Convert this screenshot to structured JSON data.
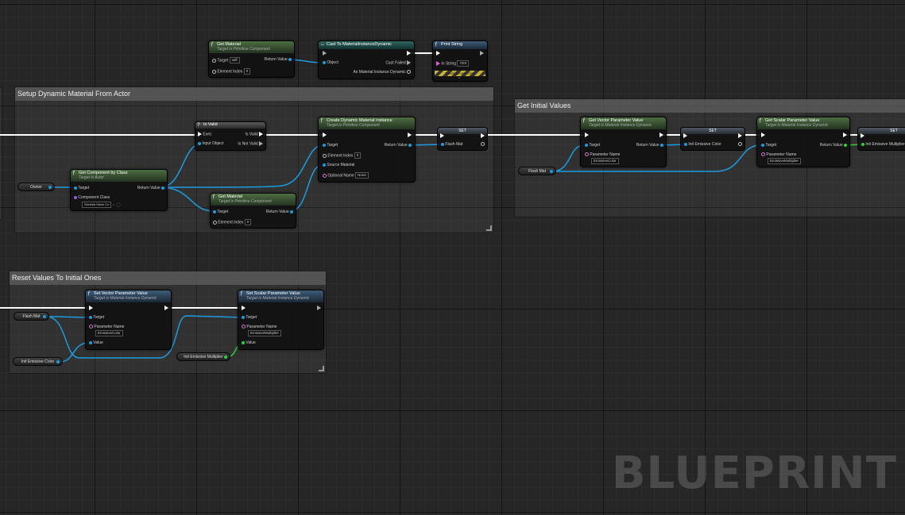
{
  "comments": {
    "setup": "Setup Dynamic Material From Actor",
    "initial": "Get Initial Values",
    "reset": "Reset Values To Initial Ones"
  },
  "nodes": {
    "get_material_top": {
      "title": "Get Material",
      "subtitle": "Target is Primitive Component",
      "target_label": "Target",
      "target_value": "self",
      "return_label": "Return Value",
      "index_label": "Element Index",
      "index_value": "0"
    },
    "cast": {
      "title": "Cast To MaterialInstanceDynamic",
      "object_label": "Object",
      "failed_label": "Cast Failed",
      "as_label": "As Material Instance Dynamic"
    },
    "print_string": {
      "title": "Print String",
      "in_string_label": "In String",
      "in_string_value": "YES",
      "dev_only": "Development Only"
    },
    "is_valid": {
      "title": "Is Valid",
      "exec_label": "Exec",
      "input_label": "Input Object",
      "valid_label": "Is Valid",
      "not_valid_label": "Is Not Valid"
    },
    "get_component": {
      "title": "Get Component by Class",
      "subtitle": "Target is Actor",
      "target_label": "Target",
      "return_label": "Return Value",
      "class_label": "Component Class",
      "class_value": "Skeletal Mesh Co"
    },
    "get_material_mid": {
      "title": "Get Material",
      "subtitle": "Target is Primitive Component",
      "target_label": "Target",
      "return_label": "Return Value",
      "index_label": "Element Index",
      "index_value": "0"
    },
    "create_dmi": {
      "title": "Create Dynamic Material Instance",
      "subtitle": "Target is Primitive Component",
      "target_label": "Target",
      "return_label": "Return Value",
      "index_label": "Element Index",
      "index_value": "0",
      "source_label": "Source Material",
      "name_label": "Optional Name",
      "name_value": "None"
    },
    "set_flash": {
      "title": "SET",
      "var_label": "Flash Mat"
    },
    "get_vector": {
      "title": "Get Vector Parameter Value",
      "subtitle": "Target is Material Instance Dynamic",
      "target_label": "Target",
      "return_label": "Return Value",
      "param_label": "Parameter Name",
      "param_value": "EmissiveColor"
    },
    "set_init_color": {
      "title": "SET",
      "var_label": "Init Emissive Color"
    },
    "get_scalar": {
      "title": "Get Scalar Parameter Value",
      "subtitle": "Target is Material Instance Dynamic",
      "target_label": "Target",
      "return_label": "Return Value",
      "param_label": "Parameter Name",
      "param_value": "EmissiveMultiplier"
    },
    "set_init_mult": {
      "title": "SET",
      "var_label": "Init Emissive Multiplier"
    },
    "set_vector": {
      "title": "Set Vector Parameter Value",
      "subtitle": "Target is Material Instance Dynamic",
      "target_label": "Target",
      "param_label": "Parameter Name",
      "param_value": "EmissiveColor",
      "value_label": "Value"
    },
    "set_scalar": {
      "title": "Set Scalar Parameter Value",
      "subtitle": "Target is Material Instance Dynamic",
      "target_label": "Target",
      "param_label": "Parameter Name",
      "param_value": "EmissiveMultiplier",
      "value_label": "Value"
    }
  },
  "variables": {
    "owner": "Owner",
    "flash_mat_1": "Flash Mat",
    "flash_mat_2": "Flash Mat",
    "init_color": "Init Emissive Color",
    "init_mult": "Init Emissive Multiplier"
  },
  "watermark": "BLUEPRINT",
  "colors": {
    "exec": "#ffffff",
    "object_pin": "#1d9be0",
    "float_pin": "#2fd03a",
    "class_pin": "#9a56e0",
    "function_header": "#4d6e42",
    "mid_header": "#3e5c78"
  }
}
